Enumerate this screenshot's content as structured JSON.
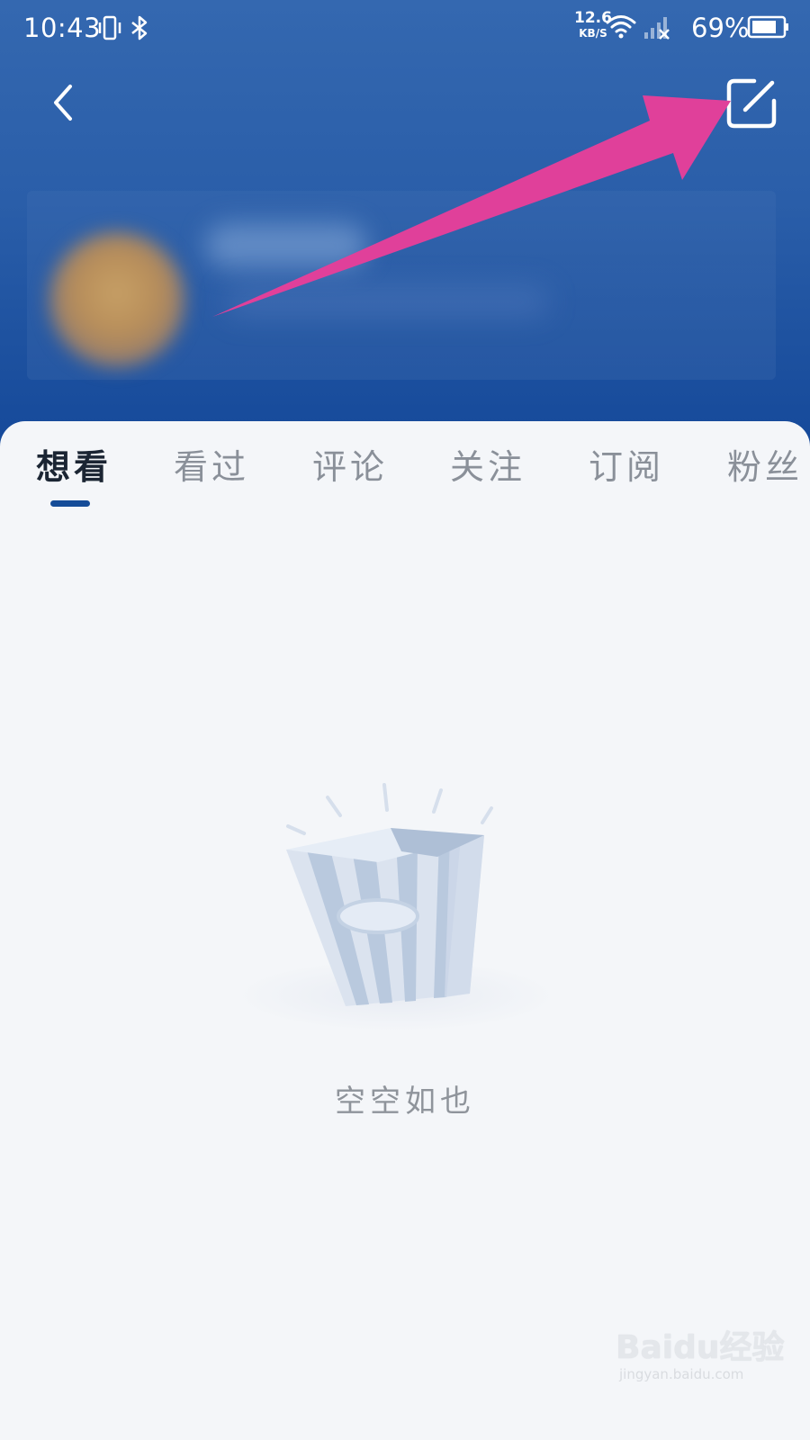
{
  "status_bar": {
    "time": "10:43",
    "net_speed_value": "12.6",
    "net_speed_unit": "KB/S",
    "battery_percent": "69%",
    "icons": [
      "vibrate-icon",
      "bluetooth-icon",
      "wifi-icon",
      "signal-icon",
      "battery-icon"
    ]
  },
  "header": {
    "back_icon": "chevron-left-icon",
    "edit_icon": "edit-icon",
    "gradient_colors": [
      "#3468b0",
      "#15499a"
    ]
  },
  "annotation": {
    "arrow_color": "#e0409a"
  },
  "tabs": [
    {
      "label": "想看",
      "active": true
    },
    {
      "label": "看过",
      "active": false
    },
    {
      "label": "评论",
      "active": false
    },
    {
      "label": "关注",
      "active": false
    },
    {
      "label": "订阅",
      "active": false
    },
    {
      "label": "粉丝",
      "active": false
    }
  ],
  "tab_indicator_color": "#154c98",
  "empty_state": {
    "text": "空空如也",
    "illustration": "popcorn-box-icon"
  },
  "watermark": {
    "logo_text": "Baidu经验",
    "url": "jingyan.baidu.com"
  }
}
